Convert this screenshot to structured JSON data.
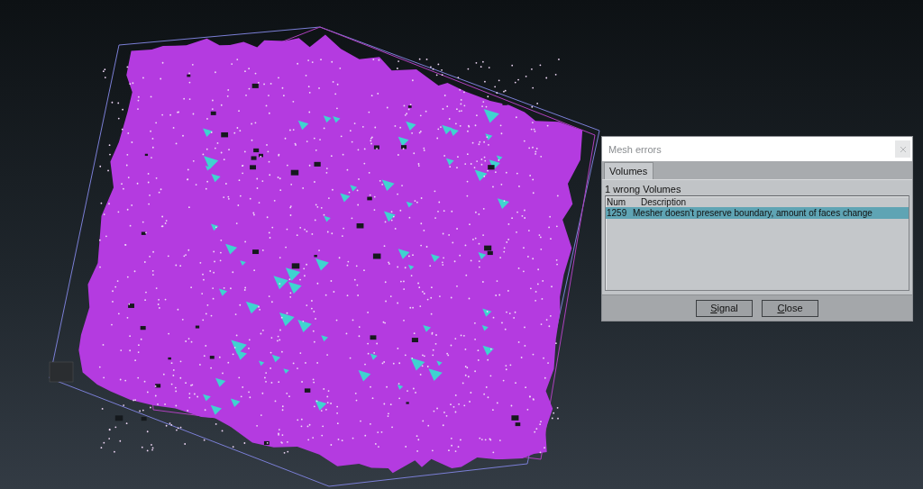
{
  "dialog": {
    "title": "Mesh errors",
    "tabs": [
      {
        "label": "Volumes",
        "selected": true
      }
    ],
    "summary": "1 wrong Volumes",
    "list": {
      "columns": [
        "Num",
        "Description"
      ],
      "rows": [
        {
          "cells": [
            "1259",
            "Mesher doesn't preserve boundary, amount of faces change"
          ],
          "selected": true
        }
      ]
    },
    "buttons": [
      "Signal",
      "Close"
    ]
  }
}
